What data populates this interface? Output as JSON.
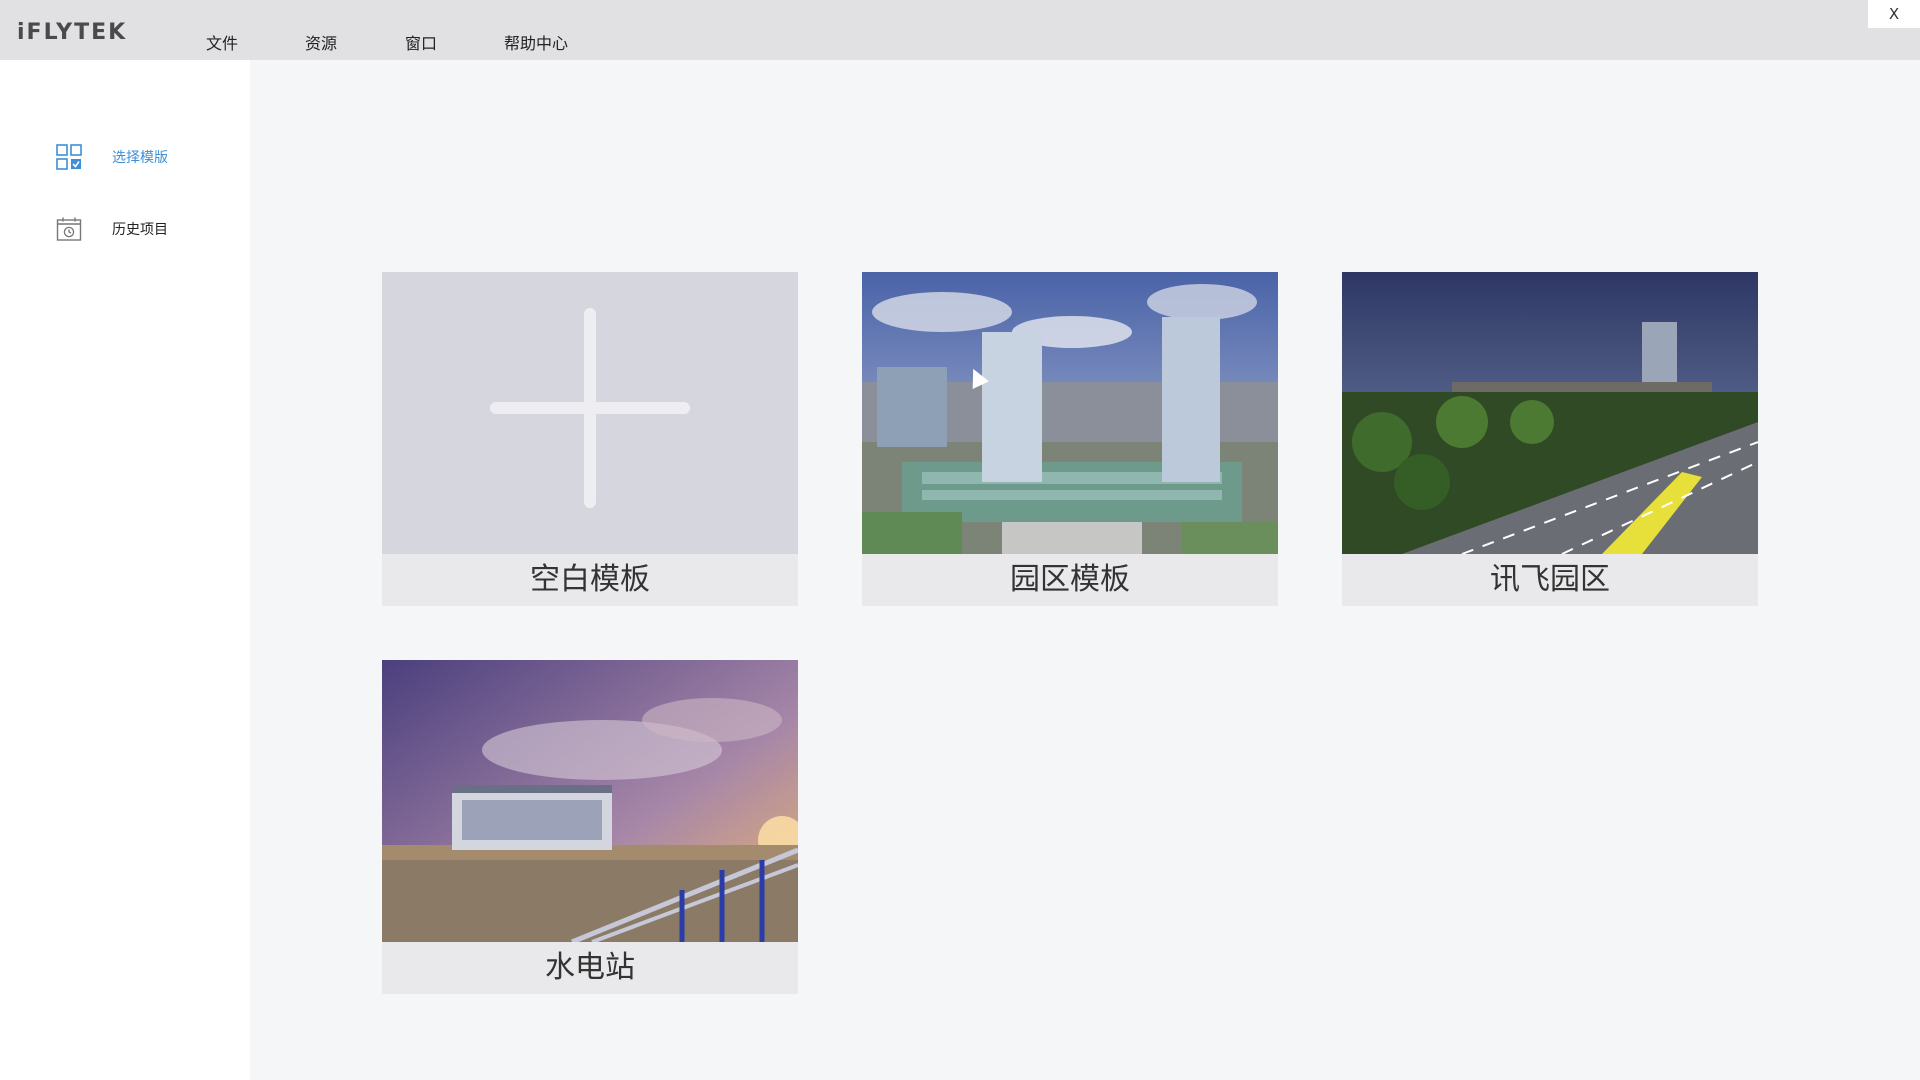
{
  "app": {
    "logo": "iFLYTEK"
  },
  "menu": [
    {
      "label": "文件"
    },
    {
      "label": "资源"
    },
    {
      "label": "窗口"
    },
    {
      "label": "帮助中心"
    }
  ],
  "window": {
    "close_label": "X"
  },
  "sidebar": {
    "items": [
      {
        "label": "选择模版",
        "icon": "template-grid-icon",
        "active": true
      },
      {
        "label": "历史项目",
        "icon": "history-calendar-icon",
        "active": false
      }
    ]
  },
  "templates": [
    {
      "title": "空白模板",
      "thumbnail": "plus-icon"
    },
    {
      "title": "园区模板",
      "thumbnail": "campus-buildings-image"
    },
    {
      "title": "讯飞园区",
      "thumbnail": "park-road-night-image"
    },
    {
      "title": "水电站",
      "thumbnail": "hydropower-station-sunset-image"
    }
  ],
  "colors": {
    "accent": "#3d8fd8",
    "topbar": "#e1e1e3",
    "card_caption": "#e9e9eb"
  }
}
